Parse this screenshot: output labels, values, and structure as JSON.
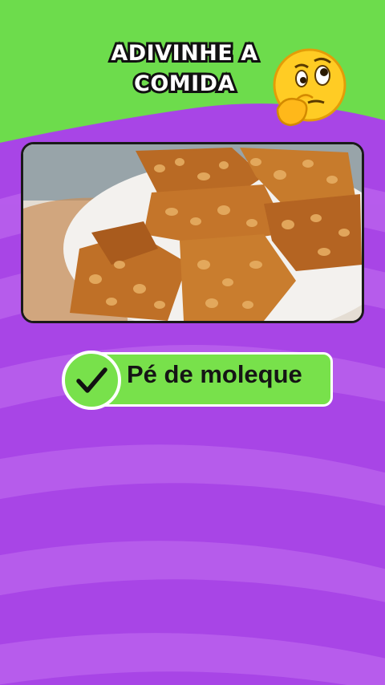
{
  "colors": {
    "header_green": "#6ddc4c",
    "purple_light": "#b653ea",
    "purple_dark": "#9a36dc",
    "answer_green": "#78e14b"
  },
  "header": {
    "title_line1": "ADIVINHE A",
    "title_line2": "COMIDA",
    "emoji_icon": "thinking-face-emoji"
  },
  "question": {
    "image_subject": "peanut-brittle-icon"
  },
  "answer": {
    "label": "Pé de moleque",
    "state_icon": "check-icon",
    "correct": true
  }
}
